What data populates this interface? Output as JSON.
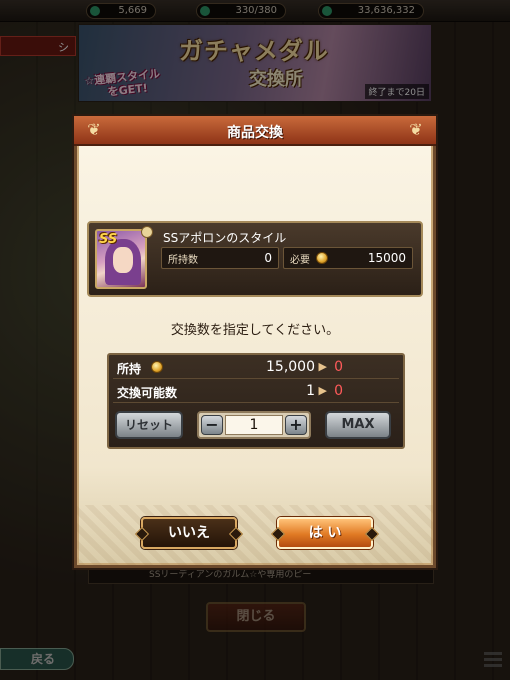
{
  "background": {
    "resources": [
      "5,669",
      "330/380",
      "33,636,332"
    ],
    "left_tab": "シ",
    "banner_title": "ガチャメダル",
    "banner_subtitle": "交換所",
    "banner_promo_line1": "☆連覇スタイル",
    "banner_promo_line2": "をGET!",
    "banner_end": "終了まで20日",
    "list_strip": "SSリーディアンのガルム☆や専用のピー",
    "close_label": "閉じる",
    "back_label": "戻る"
  },
  "dialog": {
    "title": "商品交換",
    "item": {
      "rank": "SS",
      "name": "SSアポロンのスタイル",
      "owned_label": "所持数",
      "owned_value": "0",
      "required_label": "必要",
      "required_value": "15000"
    },
    "instruction": "交換数を指定してください。",
    "summary": {
      "owned_label": "所持",
      "owned_current": "15,000",
      "owned_after": "0",
      "exchangeable_label": "交換可能数",
      "exchangeable_current": "1",
      "exchangeable_after": "0",
      "arrow": "▶"
    },
    "controls": {
      "reset_label": "リセット",
      "minus_label": "−",
      "quantity": "1",
      "plus_label": "+",
      "max_label": "MAX"
    },
    "buttons": {
      "no_label": "いいえ",
      "yes_label": "は い"
    }
  },
  "colors": {
    "header": "#b2522a",
    "panel": "#2f241b",
    "after_value": "#ff5a5a",
    "yes_button": "#e07a24"
  }
}
